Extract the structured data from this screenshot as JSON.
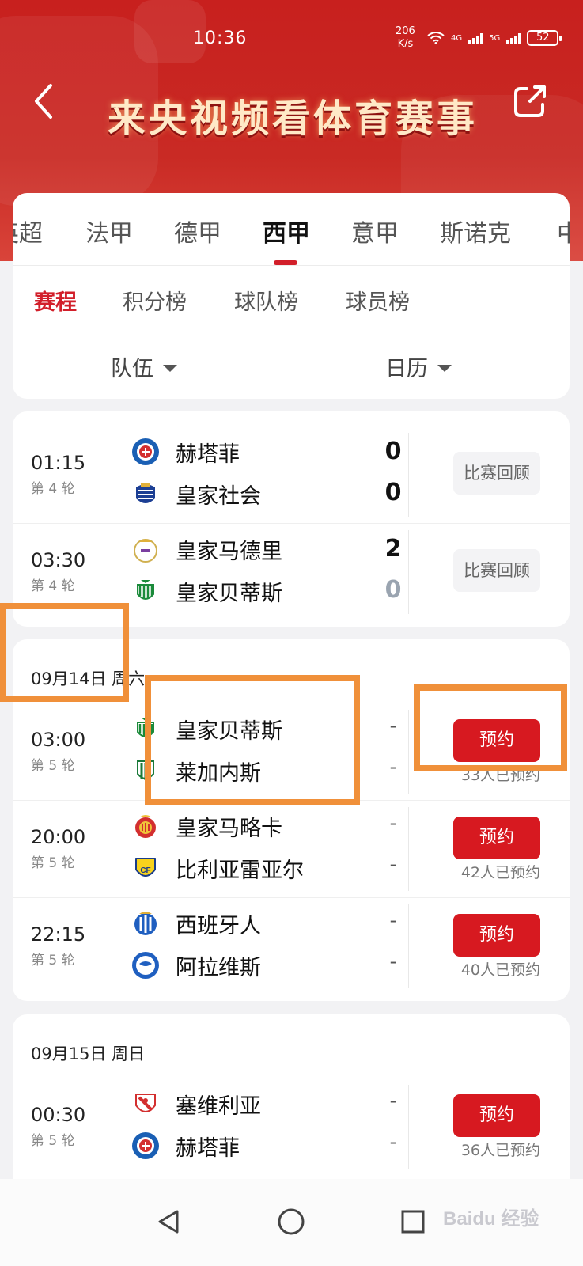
{
  "status": {
    "time": "10:36",
    "net_speed": "206",
    "net_unit": "K/s",
    "sig1": "4G",
    "sig2": "5G",
    "battery": "52"
  },
  "header": {
    "title": "来央视频看体育赛事"
  },
  "league_tabs": [
    "英超",
    "法甲",
    "德甲",
    "西甲",
    "意甲",
    "斯诺克",
    "中"
  ],
  "league_active": "西甲",
  "sub_tabs": [
    "赛程",
    "积分榜",
    "球队榜",
    "球员榜"
  ],
  "filters": {
    "team": "队伍",
    "calendar": "日历"
  },
  "matches_past": [
    {
      "time": "01:15",
      "round": "第 4 轮",
      "home": "赫塔菲",
      "away": "皇家社会",
      "home_score": "0",
      "away_score": "0",
      "action": "比赛回顾"
    },
    {
      "time": "03:30",
      "round": "第 4 轮",
      "home": "皇家马德里",
      "away": "皇家贝蒂斯",
      "home_score": "2",
      "away_score": "0",
      "action": "比赛回顾"
    }
  ],
  "day1": {
    "date": "09月14日 周六",
    "matches": [
      {
        "time": "03:00",
        "round": "第 5 轮",
        "home": "皇家贝蒂斯",
        "away": "莱加内斯",
        "home_score": "-",
        "away_score": "-",
        "action": "预约",
        "booked": "33人已预约"
      },
      {
        "time": "20:00",
        "round": "第 5 轮",
        "home": "皇家马略卡",
        "away": "比利亚雷亚尔",
        "home_score": "-",
        "away_score": "-",
        "action": "预约",
        "booked": "42人已预约"
      },
      {
        "time": "22:15",
        "round": "第 5 轮",
        "home": "西班牙人",
        "away": "阿拉维斯",
        "home_score": "-",
        "away_score": "-",
        "action": "预约",
        "booked": "40人已预约"
      }
    ]
  },
  "day2": {
    "date": "09月15日 周日",
    "matches": [
      {
        "time": "00:30",
        "round": "第 5 轮",
        "home": "塞维利亚",
        "away": "赫塔菲",
        "home_score": "-",
        "away_score": "-",
        "action": "预约",
        "booked": "36人已预约"
      }
    ]
  },
  "watermark": "Baidu 经验",
  "colors": {
    "brand_red": "#d71920",
    "header_red": "#c8201e",
    "highlight_orange": "#f0903a"
  }
}
